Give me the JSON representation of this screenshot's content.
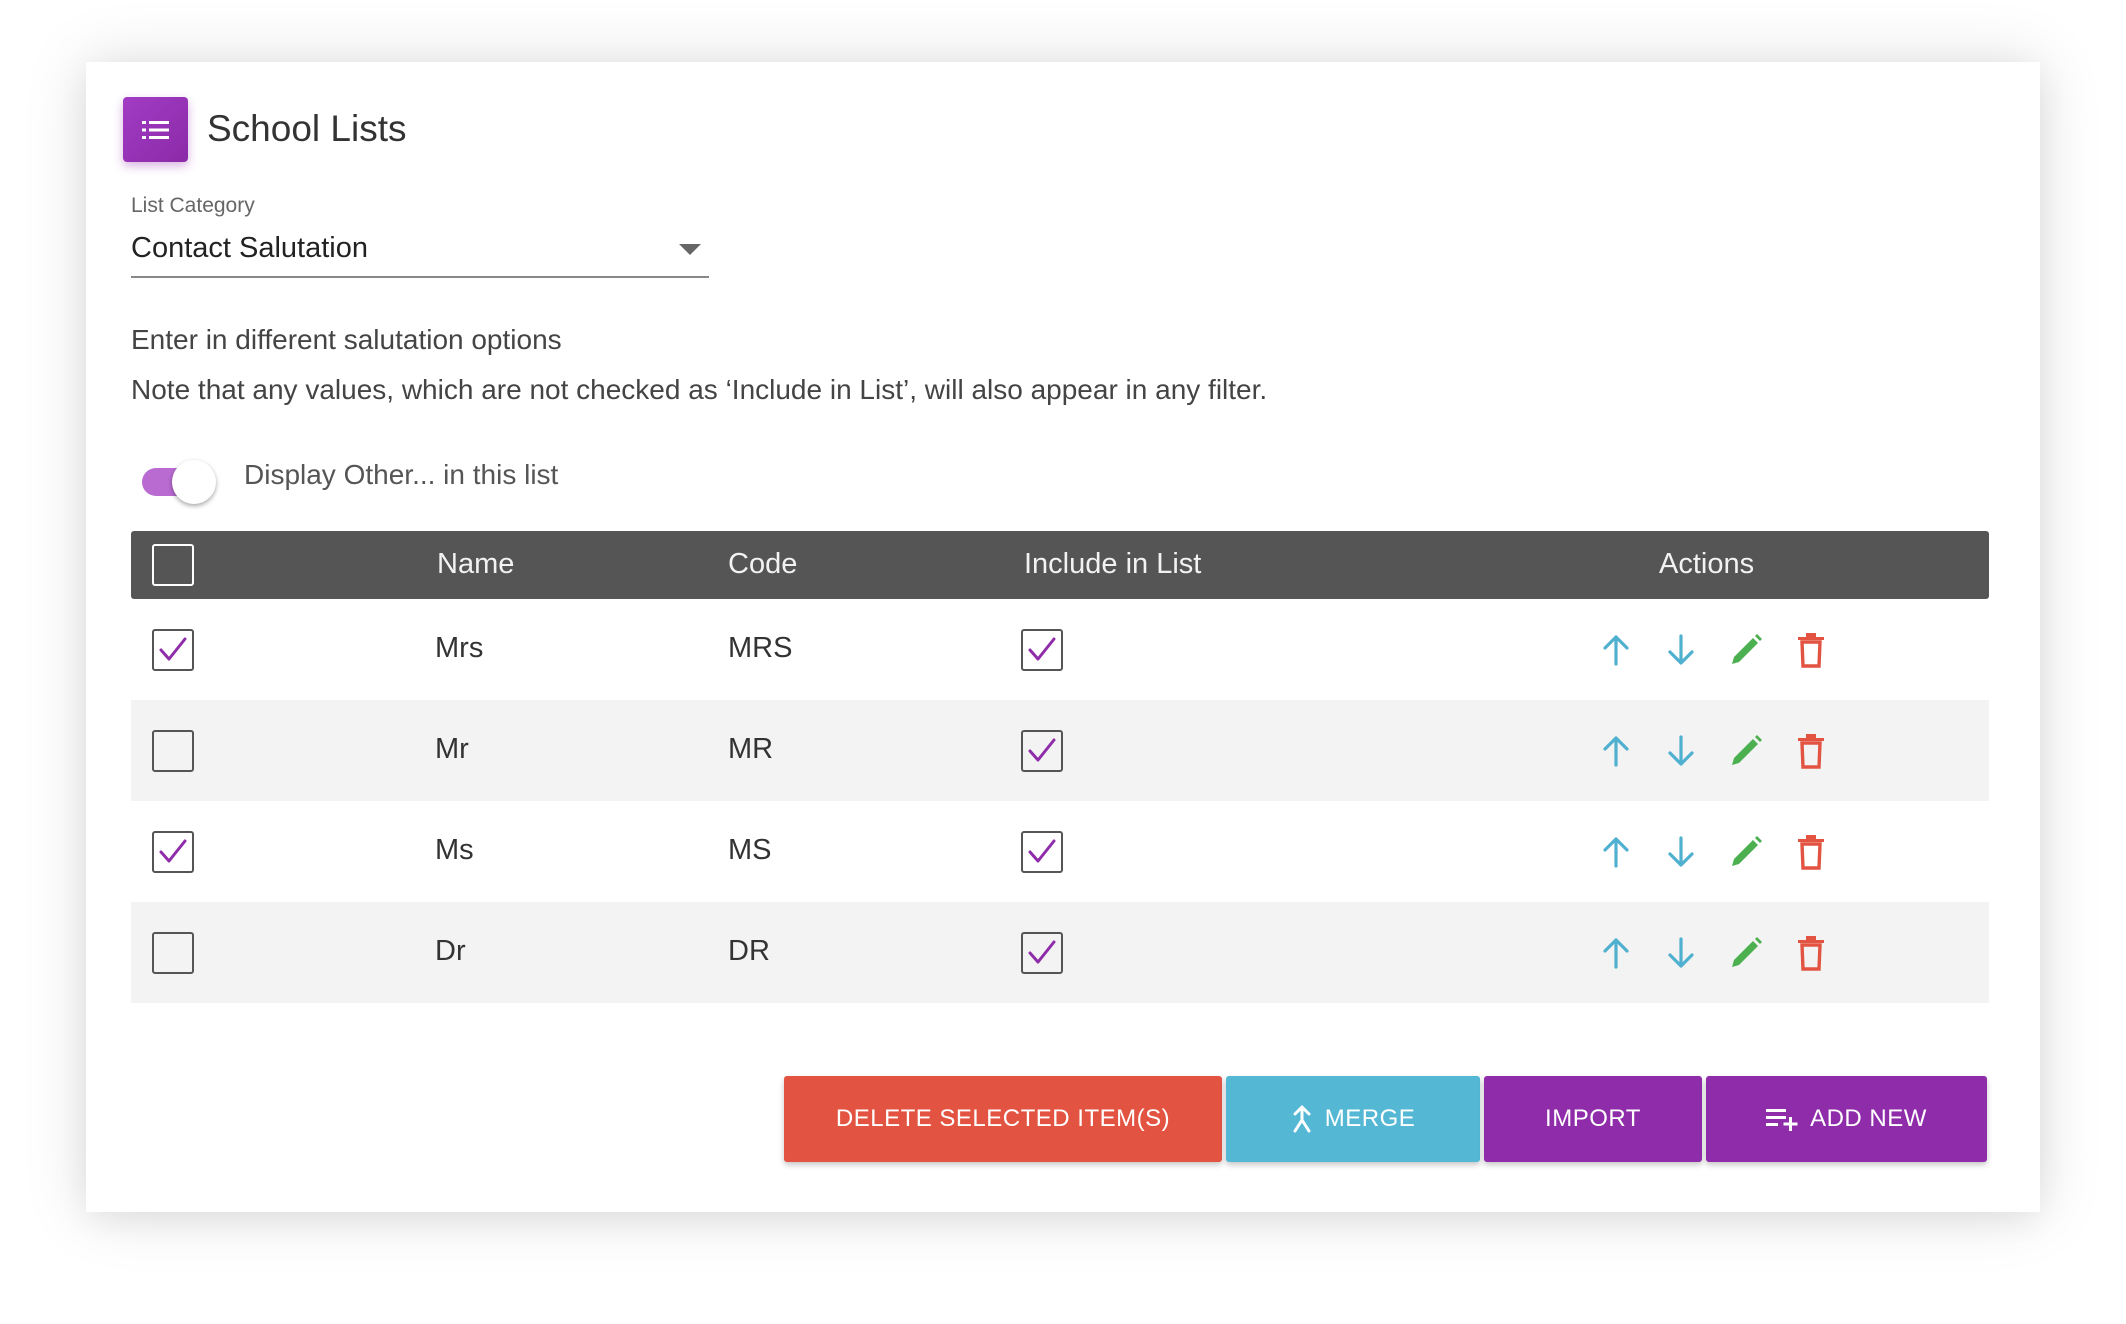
{
  "header": {
    "title": "School Lists",
    "icon": "list-icon"
  },
  "category": {
    "label": "List Category",
    "value": "Contact Salutation"
  },
  "description": {
    "line1": "Enter in different salutation options",
    "line2": "Note that any values, which are not checked as ‘Include in List’, will also appear in any filter."
  },
  "toggle": {
    "label": "Display Other... in this list",
    "on": true
  },
  "table": {
    "columns": {
      "name": "Name",
      "code": "Code",
      "include": "Include in List",
      "actions": "Actions"
    },
    "rows": [
      {
        "name": "Mrs",
        "code": "MRS",
        "selected": true,
        "include": true
      },
      {
        "name": "Mr",
        "code": "MR",
        "selected": false,
        "include": true
      },
      {
        "name": "Ms",
        "code": "MS",
        "selected": true,
        "include": true
      },
      {
        "name": "Dr",
        "code": "DR",
        "selected": false,
        "include": true
      }
    ]
  },
  "buttons": {
    "delete": "DELETE SELECTED ITEM(S)",
    "merge": "MERGE",
    "import": "IMPORT",
    "add_new": "ADD NEW"
  },
  "colors": {
    "accent": "#8e2ca9",
    "delete": "#e25441",
    "merge": "#54b7d3",
    "arrow": "#4fb0cf",
    "edit": "#4caf50",
    "trash": "#e25441",
    "header_bg": "#555555"
  }
}
